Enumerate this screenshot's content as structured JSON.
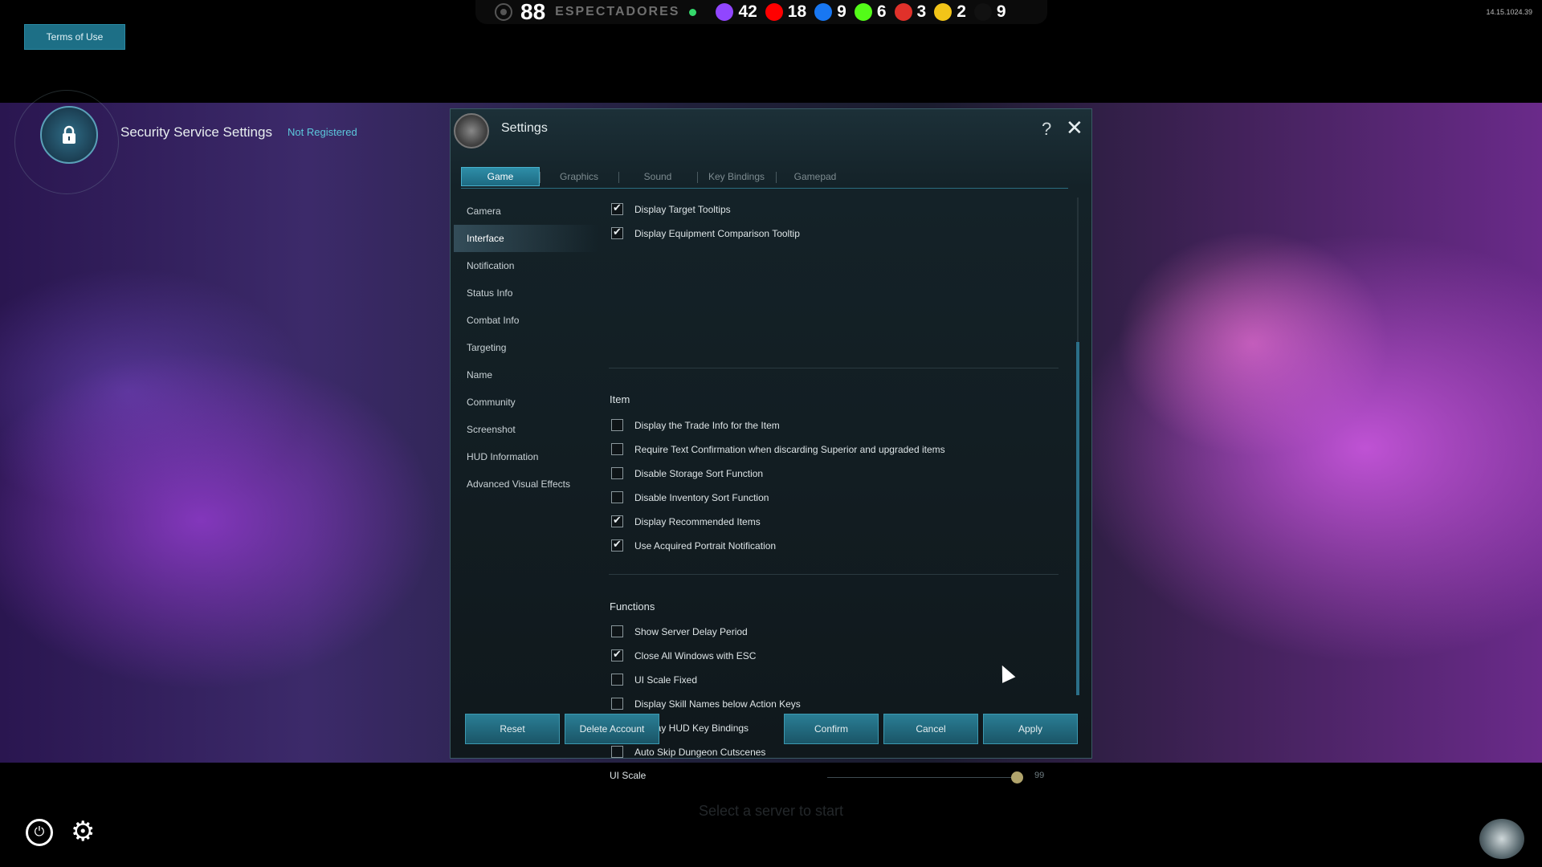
{
  "stream": {
    "viewers": "88",
    "viewers_label": "ESPECTADORES",
    "platforms": [
      {
        "icon": "twitch-icon",
        "count": "42",
        "color": "#9146ff"
      },
      {
        "icon": "youtube-icon",
        "count": "18",
        "color": "#ff0000"
      },
      {
        "icon": "facebook-icon",
        "count": "9",
        "color": "#1877f2"
      },
      {
        "icon": "kick-icon",
        "count": "6",
        "color": "#53fc18"
      },
      {
        "icon": "nimo-icon",
        "count": "3",
        "color": "#e0312a"
      },
      {
        "icon": "trovo-icon",
        "count": "2",
        "color": "#f2c418"
      },
      {
        "icon": "other-icon",
        "count": "9",
        "color": "#111111"
      }
    ],
    "timestamp": "14.15.1024.39"
  },
  "terms_label": "Terms of Use",
  "security": {
    "title": "Security Service Settings",
    "status": "Not Registered"
  },
  "dialog": {
    "title": "Settings",
    "tabs": [
      {
        "label": "Game",
        "active": true
      },
      {
        "label": "Graphics",
        "active": false
      },
      {
        "label": "Sound",
        "active": false
      },
      {
        "label": "Key Bindings",
        "active": false
      },
      {
        "label": "Gamepad",
        "active": false
      }
    ],
    "side_items": [
      "Camera",
      "Interface",
      "Notification",
      "Status Info",
      "Combat Info",
      "Targeting",
      "Name",
      "Community",
      "Screenshot",
      "HUD Information",
      "Advanced Visual Effects"
    ],
    "side_active": "Interface",
    "options_top": [
      {
        "label": "Display Target Tooltips",
        "checked": true
      },
      {
        "label": "Display Equipment Comparison Tooltip",
        "checked": true
      }
    ],
    "item_section": {
      "title": "Item",
      "options": [
        {
          "label": "Display the Trade Info for the Item",
          "checked": false
        },
        {
          "label": "Require Text Confirmation when discarding Superior and upgraded items",
          "checked": false
        },
        {
          "label": "Disable Storage Sort Function",
          "checked": false
        },
        {
          "label": "Disable Inventory Sort Function",
          "checked": false
        },
        {
          "label": "Display Recommended Items",
          "checked": true
        },
        {
          "label": "Use Acquired Portrait Notification",
          "checked": true
        }
      ]
    },
    "functions_section": {
      "title": "Functions",
      "options": [
        {
          "label": "Show Server Delay Period",
          "checked": false
        },
        {
          "label": "Close All Windows with ESC",
          "checked": true
        },
        {
          "label": "UI Scale Fixed",
          "checked": false
        },
        {
          "label": "Display Skill Names below Action Keys",
          "checked": false
        },
        {
          "label": "Display HUD Key Bindings",
          "checked": true
        },
        {
          "label": "Auto Skip Dungeon Cutscenes",
          "checked": false
        }
      ]
    },
    "ui_scale": {
      "label": "UI Scale",
      "value": "99",
      "fraction": 0.99
    },
    "buttons": {
      "reset": "Reset",
      "delete": "Delete Account",
      "confirm": "Confirm",
      "cancel": "Cancel",
      "apply": "Apply"
    }
  },
  "footer": {
    "select_server": "Select a server to start"
  }
}
